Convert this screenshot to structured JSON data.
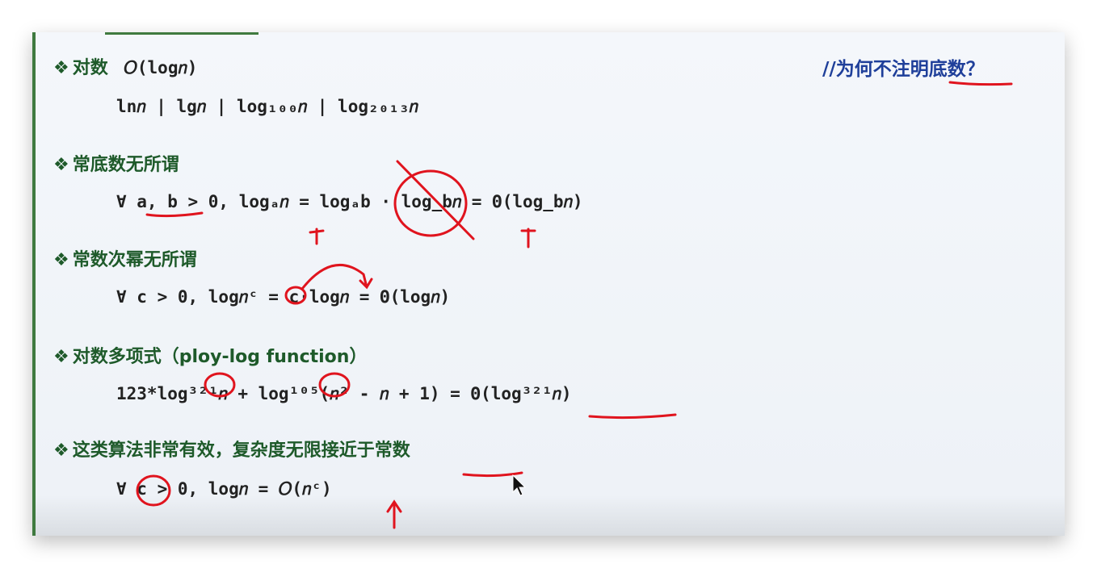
{
  "note": "//为何不注明底数？",
  "sections": [
    {
      "heading": "对数",
      "heading_math": "𝑂(log𝑛)",
      "formula": "ln𝑛 | lg𝑛 | log₁₀₀𝑛 | log₂₀₁₃𝑛"
    },
    {
      "heading": "常底数无所谓",
      "formula": "∀ a, b > 0, logₐ𝑛 = logₐb · log_b𝑛 = Θ(log_b𝑛)"
    },
    {
      "heading": "常数次幂无所谓",
      "formula": "∀ c > 0, log𝑛ᶜ = c·log𝑛 = Θ(log𝑛)"
    },
    {
      "heading": "对数多项式（ploy-log function）",
      "formula": "123*log³²¹𝑛 + log¹⁰⁵(𝑛² - 𝑛 + 1) = Θ(log³²¹𝑛)"
    },
    {
      "heading": "这类算法非常有效，复杂度无限接近于常数",
      "formula": "∀ c > 0, log𝑛 = 𝑂(𝑛ᶜ)"
    }
  ],
  "colors": {
    "heading": "#1e5a2a",
    "note": "#1f3f9a",
    "ink": "#e0141e",
    "rule": "#3f7a3f"
  },
  "icons": {
    "bullet": "diamond-bullet-icon",
    "cursor": "mouse-pointer-icon"
  }
}
